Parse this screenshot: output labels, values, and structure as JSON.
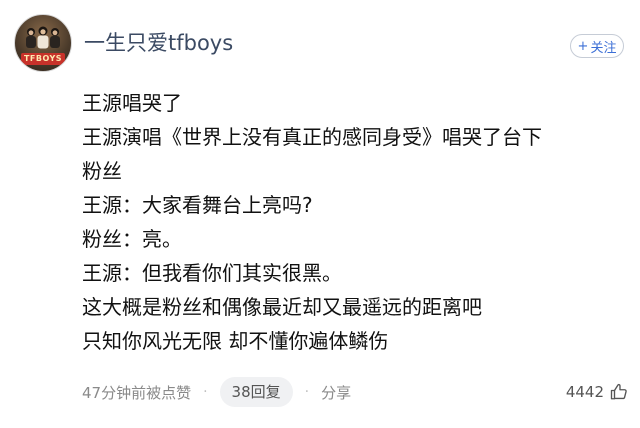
{
  "user": {
    "name": "一生只爱tfboys",
    "avatar_text": "TFBOYS"
  },
  "follow_button": {
    "icon": "+",
    "label": "关注"
  },
  "post": {
    "lines": [
      "王源唱哭了",
      "王源演唱《世界上没有真正的感同身受》唱哭了台下",
      "粉丝",
      "王源：大家看舞台上亮吗?",
      "粉丝：亮。",
      "王源：但我看你们其实很黑。",
      "这大概是粉丝和偶像最近却又最遥远的距离吧",
      "只知你风光无限 却不懂你遍体鳞伤"
    ]
  },
  "footer": {
    "timestamp": "47分钟前被点赞",
    "separator": "·",
    "replies": "38回复",
    "share": "分享",
    "likes": "4442"
  },
  "colors": {
    "username": "#3b4a63",
    "accent": "#3c6fd6",
    "muted": "#8a8a8a"
  }
}
